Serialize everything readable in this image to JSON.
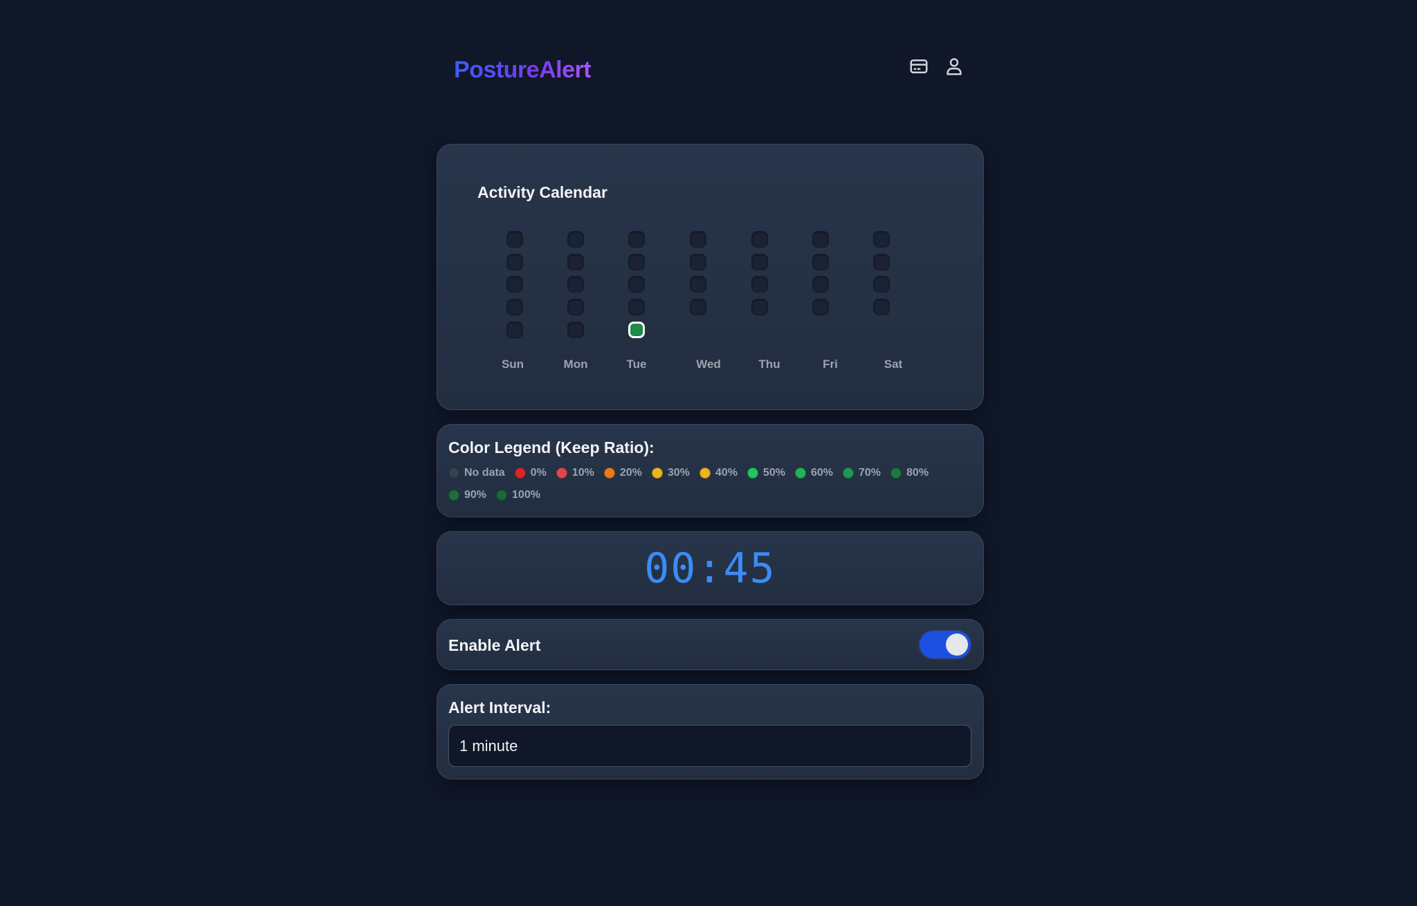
{
  "header": {
    "logo": "PostureAlert",
    "icons": [
      "credit-card-icon",
      "user-icon"
    ]
  },
  "calendar": {
    "title": "Activity Calendar",
    "days_of_week": [
      "Sun",
      "Mon",
      "Tue",
      "Wed",
      "Thu",
      "Fri",
      "Sat"
    ],
    "today_color": "#1f8a49"
  },
  "legend": {
    "title": "Color Legend (Keep Ratio):",
    "items": [
      {
        "label": "No data",
        "color": "#374151"
      },
      {
        "label": "0%",
        "color": "#dc2626"
      },
      {
        "label": "10%",
        "color": "#e0474c"
      },
      {
        "label": "20%",
        "color": "#ea7a1a"
      },
      {
        "label": "30%",
        "color": "#e9b520"
      },
      {
        "label": "40%",
        "color": "#e9b520"
      },
      {
        "label": "50%",
        "color": "#22c55e"
      },
      {
        "label": "60%",
        "color": "#22b35a"
      },
      {
        "label": "70%",
        "color": "#1f9a4e"
      },
      {
        "label": "80%",
        "color": "#1b7a40"
      },
      {
        "label": "90%",
        "color": "#1d6e3b"
      },
      {
        "label": "100%",
        "color": "#1a6a38"
      }
    ]
  },
  "timer": {
    "display": "00:45"
  },
  "alert_toggle": {
    "label": "Enable Alert",
    "enabled": true
  },
  "alert_interval": {
    "label": "Alert Interval:",
    "selected": "1 minute"
  }
}
